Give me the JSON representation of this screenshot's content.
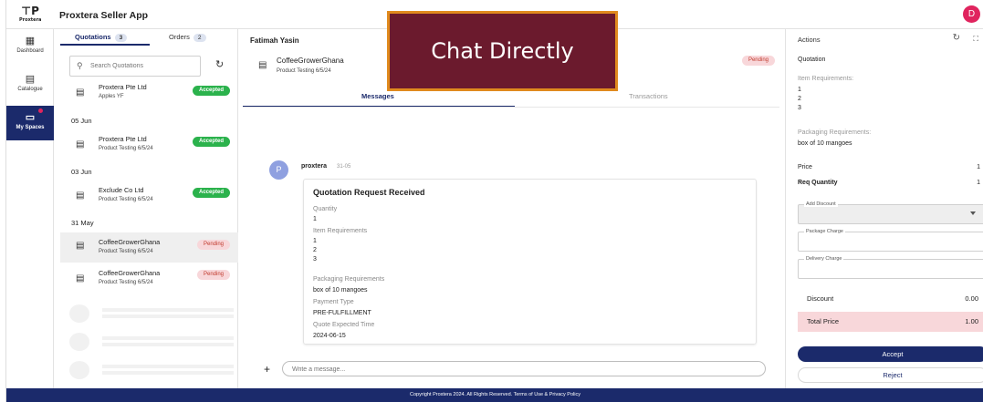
{
  "app": {
    "logo_word": "Proxtera",
    "title": "Proxtera Seller App",
    "avatar_initial": "D",
    "avatar_color": "#e0245e",
    "accent": "#1b2a6b"
  },
  "nav": [
    {
      "label": "Dashboard",
      "icon": "dashboard-icon"
    },
    {
      "label": "Catalogue",
      "icon": "catalogue-icon"
    },
    {
      "label": "My Spaces",
      "icon": "chat-icon",
      "active": true
    }
  ],
  "list": {
    "tabs": [
      {
        "label": "Quotations",
        "count": "3"
      },
      {
        "label": "Orders",
        "count": "2"
      }
    ],
    "search_placeholder": "Search Quotations",
    "items": [
      {
        "name": "Proxtera Pte Ltd",
        "sub": "Apples YF",
        "status": "Accepted"
      },
      {
        "name": "Proxtera Pte Ltd",
        "sub": "Product Testing 6/5/24",
        "status": "Accepted"
      },
      {
        "name": "Exclude Co Ltd",
        "sub": "Product Testing 6/5/24",
        "status": "Accepted"
      },
      {
        "name": "CoffeeGrowerGhana",
        "sub": "Product Testing 6/5/24",
        "status": "Pending"
      },
      {
        "name": "CoffeeGrowerGhana",
        "sub": "Product Testing 6/5/24",
        "status": "Pending"
      }
    ],
    "dates": [
      "05 Jun",
      "03 Jun",
      "31 May"
    ]
  },
  "chat": {
    "user": "Fatimah Yasin",
    "title": "CoffeeGrowerGhana",
    "subtitle": "Product Testing 6/5/24",
    "status": "Pending",
    "tabs": [
      "Messages",
      "Transactions"
    ],
    "promo": "Chat Directly",
    "message": {
      "avatar": "P",
      "sender": "proxtera",
      "date": "31-05",
      "heading": "Quotation Request Received",
      "quantity_label": "Quantity",
      "quantity": "1",
      "item_req_label": "Item Requirements",
      "item_req": [
        "1",
        "2",
        "3"
      ],
      "packaging_label": "Packaging Requirements",
      "packaging": "box of 10 mangoes",
      "payment_label": "Payment Type",
      "payment": "PRE-FULFILLMENT",
      "quote_time_label": "Quote Expected Time",
      "quote_time": "2024-06-15"
    },
    "composer_placeholder": "Write a message..."
  },
  "actions": {
    "title": "Actions",
    "quotation_label": "Quotation",
    "item_req_label": "Item Requirements:",
    "item_req": [
      "1",
      "2",
      "3"
    ],
    "packaging_label": "Packaging Requirements:",
    "packaging": "box of 10 mangoes",
    "price_label": "Price",
    "price": "1",
    "qty_label": "Req Quantity",
    "qty": "1",
    "discount_field": "Add Discount",
    "package_field": "Package Charge",
    "delivery_field": "Delivery Charge",
    "discount_label": "Discount",
    "discount": "0.00",
    "total_label": "Total Price",
    "total": "1.00",
    "accept": "Accept",
    "reject": "Reject"
  },
  "footer": "Copyright Proxtera 2024. All Rights Reserved. Terms of Use & Privacy Policy"
}
